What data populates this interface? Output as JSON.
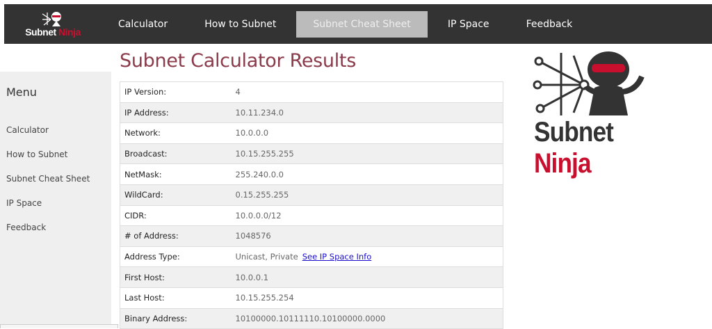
{
  "brand": {
    "name_a": "Subnet",
    "name_b": "Ninja"
  },
  "nav": [
    {
      "label": "Calculator"
    },
    {
      "label": "How to Subnet"
    },
    {
      "label": "Subnet Cheat Sheet"
    },
    {
      "label": "IP Space"
    },
    {
      "label": "Feedback"
    }
  ],
  "sidebar": {
    "title": "Menu",
    "items": [
      {
        "label": "Calculator"
      },
      {
        "label": "How to Subnet"
      },
      {
        "label": "Subnet Cheat Sheet"
      },
      {
        "label": "IP Space"
      },
      {
        "label": "Feedback"
      }
    ]
  },
  "page_title": "Subnet Calculator Results",
  "results": [
    {
      "label": "IP Version:",
      "value": "4"
    },
    {
      "label": "IP Address:",
      "value": "10.11.234.0"
    },
    {
      "label": "Network:",
      "value": "10.0.0.0"
    },
    {
      "label": "Broadcast:",
      "value": "10.15.255.255"
    },
    {
      "label": "NetMask:",
      "value": "255.240.0.0"
    },
    {
      "label": "WildCard:",
      "value": "0.15.255.255"
    },
    {
      "label": "CIDR:",
      "value": "10.0.0.0/12"
    },
    {
      "label": "# of Address:",
      "value": "1048576"
    },
    {
      "label": "Address Type:",
      "value": "Unicast, Private",
      "link": "See IP Space Info"
    },
    {
      "label": "First Host:",
      "value": "10.0.0.1"
    },
    {
      "label": "Last Host:",
      "value": "10.15.255.254"
    },
    {
      "label": "Binary Address:",
      "value": "10100000.10111110.10100000.0000"
    }
  ]
}
